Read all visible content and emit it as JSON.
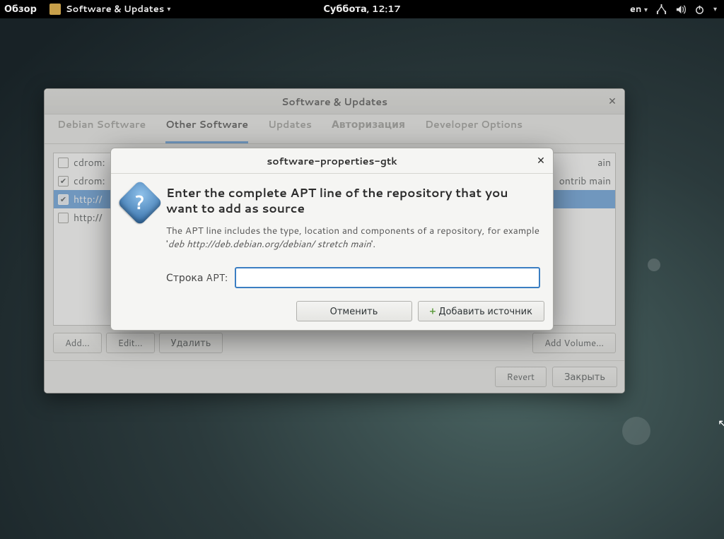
{
  "topbar": {
    "activities": "Обзор",
    "app_name": "Software & Updates",
    "clock": "Суббота, 12:17",
    "lang": "en"
  },
  "window": {
    "title": "Software & Updates",
    "tabs": [
      "Debian Software",
      "Other Software",
      "Updates",
      "Авторизация",
      "Developer Options"
    ],
    "active_tab": 1,
    "sources": [
      {
        "checked": false,
        "selected": false,
        "label": "cdrom:"
      },
      {
        "checked": true,
        "selected": false,
        "label": "cdrom:",
        "tail": "ontrib main",
        "tail_prefix": "ain"
      },
      {
        "checked": true,
        "selected": true,
        "label": "http://"
      },
      {
        "checked": false,
        "selected": false,
        "label": "http://"
      }
    ],
    "buttons": {
      "add": "Add...",
      "edit": "Edit...",
      "remove": "Удалить",
      "add_volume": "Add Volume...",
      "revert": "Revert",
      "close": "Закрыть"
    }
  },
  "modal": {
    "title": "software-properties-gtk",
    "heading": "Enter the complete APT line of the repository that you want to add as source",
    "description_lead": "The APT line includes the type, location and components of a repository, for example  '",
    "description_example": "deb http://deb.debian.org/debian/ stretch main",
    "description_tail": "'.",
    "field_label": "Строка APT:",
    "field_value": "",
    "cancel": "Отменить",
    "add_source": "Добавить источник"
  }
}
